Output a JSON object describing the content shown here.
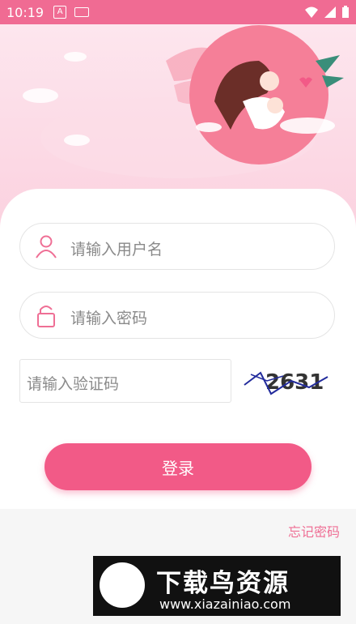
{
  "status_bar": {
    "time": "10:19",
    "a_badge": "A"
  },
  "login": {
    "username_placeholder": "请输入用户名",
    "password_placeholder": "请输入密码",
    "captcha_placeholder": "请输入验证码",
    "captcha_text": "2631",
    "login_button": "登录",
    "forgot_password": "忘记密码"
  },
  "watermark": {
    "title": "下载鸟资源",
    "url": "www.xiazainiao.com"
  },
  "colors": {
    "accent": "#f25a87",
    "status_bar": "#f06b93",
    "link": "#ef6f95"
  }
}
